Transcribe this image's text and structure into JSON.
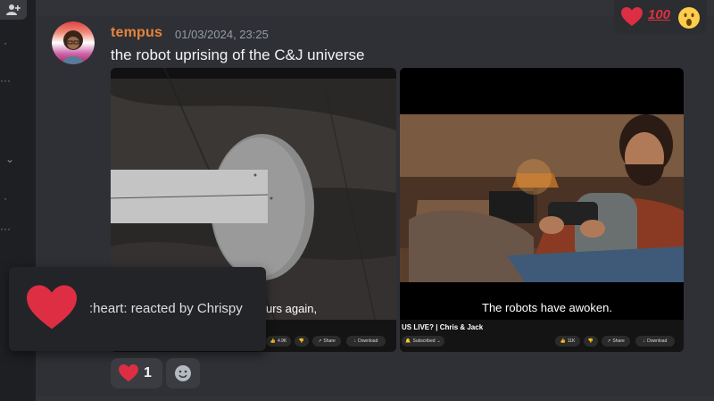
{
  "message": {
    "username": "tempus",
    "timestamp": "01/03/2024, 23:25",
    "text": "the robot uprising of the C&J universe"
  },
  "videos": [
    {
      "caption": "urs again,",
      "bottom_title": "",
      "likes": "4.9K",
      "share_label": "Share",
      "download_label": "Download"
    },
    {
      "caption": "The robots have awoken.",
      "bottom_title": "US LIVE? | Chris & Jack",
      "subscribed_label": "Subscribed",
      "likes": "11K",
      "share_label": "Share",
      "download_label": "Download"
    }
  ],
  "reaction_picker": {
    "emojis": [
      "heart",
      "100",
      "open-mouth"
    ],
    "hundred_text": "100"
  },
  "tooltip": {
    "text": ":heart: reacted by Chrispy"
  },
  "reactions": [
    {
      "emoji": "heart",
      "count": "1"
    },
    {
      "emoji": "add-reaction",
      "count": ""
    }
  ],
  "colors": {
    "username": "#e8843c",
    "heart": "#dd2e44",
    "background": "#313338"
  }
}
